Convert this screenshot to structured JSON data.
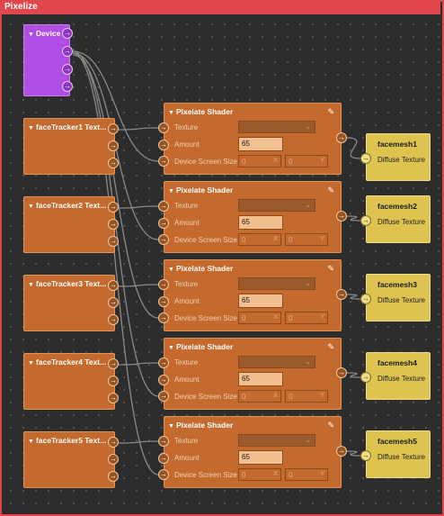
{
  "group": {
    "title": "Pixelize",
    "color": "#e0474c"
  },
  "device": {
    "title": "Device",
    "color": "#b04ee3"
  },
  "trackers": [
    {
      "title": "faceTracker1 Text..."
    },
    {
      "title": "faceTracker2 Text..."
    },
    {
      "title": "faceTracker3 Text..."
    },
    {
      "title": "faceTracker4 Text..."
    },
    {
      "title": "faceTracker5 Text..."
    }
  ],
  "shaders": [
    {
      "title": "Pixelate Shader",
      "texture_label": "Texture",
      "amount_label": "Amount",
      "amount": "65",
      "screen_label": "Device Screen Size",
      "x": "0",
      "y": "0"
    },
    {
      "title": "Pixelate Shader",
      "texture_label": "Texture",
      "amount_label": "Amount",
      "amount": "65",
      "screen_label": "Device Screen Size",
      "x": "0",
      "y": "0"
    },
    {
      "title": "Pixelate Shader",
      "texture_label": "Texture",
      "amount_label": "Amount",
      "amount": "65",
      "screen_label": "Device Screen Size",
      "x": "0",
      "y": "0"
    },
    {
      "title": "Pixelate Shader",
      "texture_label": "Texture",
      "amount_label": "Amount",
      "amount": "65",
      "screen_label": "Device Screen Size",
      "x": "0",
      "y": "0"
    },
    {
      "title": "Pixelate Shader",
      "texture_label": "Texture",
      "amount_label": "Amount",
      "amount": "65",
      "screen_label": "Device Screen Size",
      "x": "0",
      "y": "0"
    }
  ],
  "meshes": [
    {
      "title": "facemesh1",
      "input": "Diffuse Texture"
    },
    {
      "title": "facemesh2",
      "input": "Diffuse Texture"
    },
    {
      "title": "facemesh3",
      "input": "Diffuse Texture"
    },
    {
      "title": "facemesh4",
      "input": "Diffuse Texture"
    },
    {
      "title": "facemesh5",
      "input": "Diffuse Texture"
    }
  ],
  "labels": {
    "x_axis": "X",
    "y_axis": "Y"
  },
  "icons": {
    "collapse": "caret-down-icon",
    "edit": "pencil-icon",
    "port": "arrow-right-icon",
    "dropdown": "chevron-down-icon"
  },
  "colors": {
    "shader": "#c56a2e",
    "mesh": "#dfc351",
    "wire": "#8a8a8a"
  }
}
